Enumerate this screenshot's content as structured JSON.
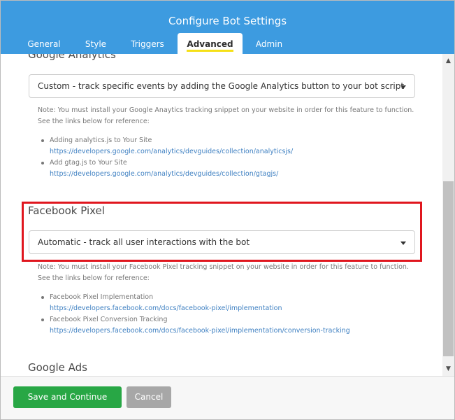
{
  "dialog": {
    "title": "Configure Bot Settings"
  },
  "tabs": [
    {
      "label": "General"
    },
    {
      "label": "Style"
    },
    {
      "label": "Triggers"
    },
    {
      "label": "Advanced"
    },
    {
      "label": "Admin"
    }
  ],
  "active_tab": "Advanced",
  "google_analytics": {
    "title": "Google Analytics",
    "selected": "Custom - track specific events by adding the Google Analytics button to your bot script",
    "note": "Note: You must install your Google Anaytics tracking snippet on your website in order for this feature to function. See the links below for reference:",
    "refs": [
      {
        "label": "Adding analytics.js to Your Site",
        "url": "https://developers.google.com/analytics/devguides/collection/analyticsjs/"
      },
      {
        "label": "Add gtag.js to Your Site",
        "url": "https://developers.google.com/analytics/devguides/collection/gtagjs/"
      }
    ]
  },
  "facebook_pixel": {
    "title": "Facebook Pixel",
    "selected": "Automatic - track all user interactions with the bot",
    "note": "Note: You must install your Facebook Pixel tracking snippet on your website in order for this feature to function. See the links below for reference:",
    "refs": [
      {
        "label": "Facebook Pixel Implementation",
        "url": "https://developers.facebook.com/docs/facebook-pixel/implementation"
      },
      {
        "label": "Facebook Pixel Conversion Tracking",
        "url": "https://developers.facebook.com/docs/facebook-pixel/implementation/conversion-tracking"
      }
    ]
  },
  "google_ads": {
    "title": "Google Ads"
  },
  "footer": {
    "save_label": "Save and Continue",
    "cancel_label": "Cancel"
  },
  "colors": {
    "header": "#3d9be0",
    "active_tab_underline": "#f5e017",
    "highlight": "#e0161e",
    "save": "#28a745",
    "cancel": "#a7a7a7",
    "link": "#3d7fc1"
  }
}
